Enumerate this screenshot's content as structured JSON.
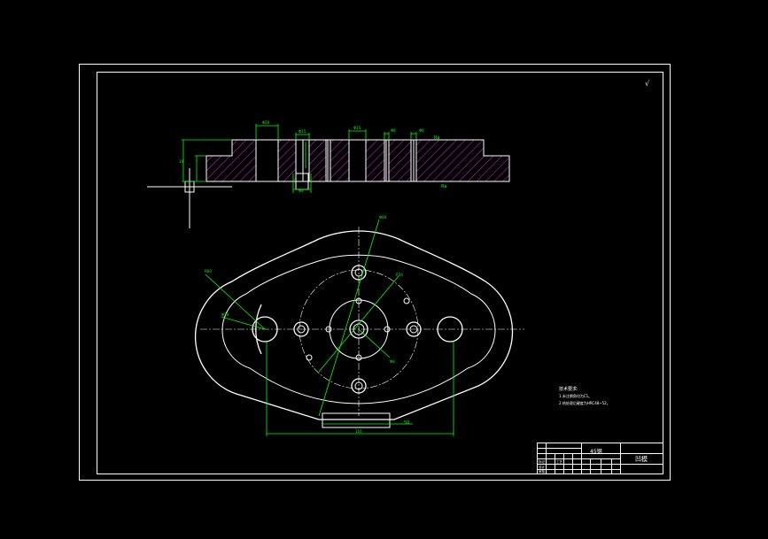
{
  "roughness_note": "√",
  "section_dims": {
    "top1": "Φ20",
    "top2": "Φ15",
    "top3": "Φ8",
    "top4": "Φ15",
    "top5": "Φ8",
    "left_height": "19",
    "hole_small": "Φ8",
    "ra1": "Ra",
    "ra2": "Ra"
  },
  "plan_dims": {
    "r1": "R60",
    "r2": "Φ80",
    "r3": "R34",
    "d1": "Φ20",
    "d2": "Φ8",
    "bottom": "116",
    "right": "50"
  },
  "notes": {
    "heading": "技术要求:",
    "line1": "1.未注倒角均为C1。",
    "line2": "2.热处理后硬度为HRC48~52。"
  },
  "title_block": {
    "material": "45钢",
    "name": "凹模",
    "rows": [
      "标记",
      "设计",
      "审核",
      "工艺"
    ]
  }
}
